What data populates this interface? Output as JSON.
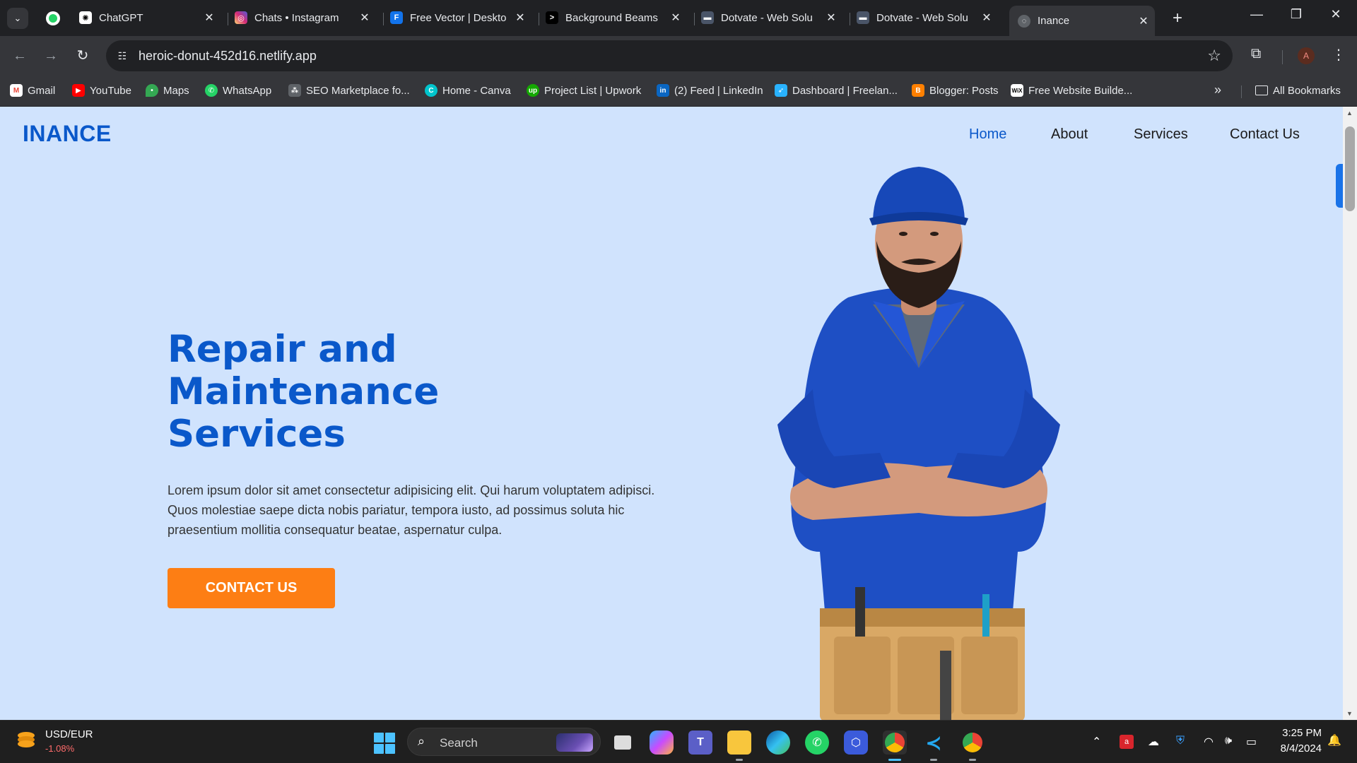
{
  "browser": {
    "tabs": [
      {
        "title": "ChatGPT",
        "favicon": "chatgpt-icon",
        "color": "#ffffff"
      },
      {
        "title": "Chats • Instagram",
        "favicon": "instagram-icon",
        "color": "#d62976"
      },
      {
        "title": "Free Vector | Deskto",
        "favicon": "freepik-icon",
        "color": "#1273eb"
      },
      {
        "title": "Background Beams",
        "favicon": "aceternity-icon",
        "color": "#000000"
      },
      {
        "title": "Dotvate - Web Solu",
        "favicon": "dotvate-icon",
        "color": "#4a5568"
      },
      {
        "title": "Dotvate - Web Solu",
        "favicon": "dotvate-icon",
        "color": "#4a5568"
      },
      {
        "title": "Inance",
        "favicon": "globe-icon",
        "color": "#9aa0a6"
      }
    ],
    "url": "heroic-donut-452d16.netlify.app",
    "profile_initial": "A",
    "bookmarks": [
      {
        "label": "Gmail",
        "icon": "gmail-icon",
        "color": "#ea4335"
      },
      {
        "label": "YouTube",
        "icon": "youtube-icon",
        "color": "#ff0000"
      },
      {
        "label": "Maps",
        "icon": "maps-icon",
        "color": "#34a853"
      },
      {
        "label": "WhatsApp",
        "icon": "whatsapp-icon",
        "color": "#25d366"
      },
      {
        "label": "SEO Marketplace fo...",
        "icon": "seo-icon",
        "color": "#8ab4f8"
      },
      {
        "label": "Home - Canva",
        "icon": "canva-icon",
        "color": "#00c4cc"
      },
      {
        "label": "Project List | Upwork",
        "icon": "upwork-icon",
        "color": "#14a800"
      },
      {
        "label": "(2) Feed | LinkedIn",
        "icon": "linkedin-icon",
        "color": "#0a66c2"
      },
      {
        "label": "Dashboard | Freelan...",
        "icon": "freelancer-icon",
        "color": "#29b2fe"
      },
      {
        "label": "Blogger: Posts",
        "icon": "blogger-icon",
        "color": "#ff8000"
      },
      {
        "label": "Free Website Builde...",
        "icon": "wix-icon",
        "color": "#ffffff"
      }
    ],
    "all_bookmarks": "All Bookmarks"
  },
  "site": {
    "logo": "INANCE",
    "nav": [
      "Home",
      "About",
      "Services",
      "Contact Us"
    ],
    "hero_title": "Repair and Maintenance Services",
    "hero_text": "Lorem ipsum dolor sit amet consectetur adipisicing elit. Qui harum voluptatem adipisci. Quos molestiae saepe dicta nobis pariatur, tempora iusto, ad possimus soluta hic praesentium mollitia consequatur beatae, aspernatur culpa.",
    "cta": "CONTACT US",
    "accent": "#0a58ca",
    "cta_color": "#fd7e14",
    "background": "#d0e3fd"
  },
  "taskbar": {
    "widget_title": "USD/EUR",
    "widget_change": "-1.08%",
    "search_label": "Search",
    "apps": [
      "task-view-icon",
      "copilot-icon",
      "teams-icon",
      "file-explorer-icon",
      "edge-icon",
      "whatsapp-icon",
      "settings-icon",
      "chrome-icon",
      "vscode-icon",
      "chrome-icon"
    ],
    "time": "3:25 PM",
    "date": "8/4/2024"
  }
}
